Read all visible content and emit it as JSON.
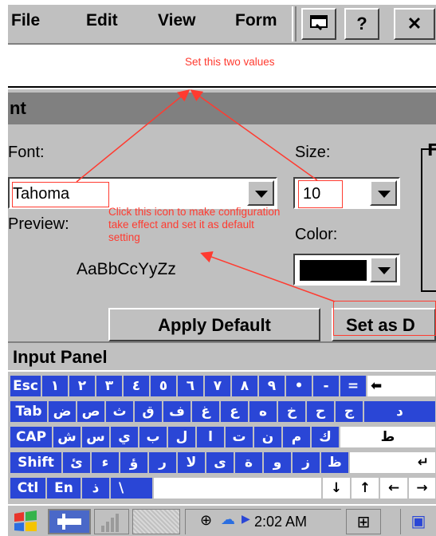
{
  "menu": {
    "file": "File",
    "edit": "Edit",
    "view": "View",
    "format": "Form",
    "help_btn": "?",
    "close_btn": "✕"
  },
  "dialog": {
    "title": "nt",
    "font_label": "Font:",
    "font_value": "Tahoma",
    "size_label": "Size:",
    "size_value": "10",
    "preview_label": "Preview:",
    "preview_text": "AaBbCcYyZz",
    "color_label": "Color:",
    "color_value": "#000000",
    "apply_default": "Apply Default",
    "set_as_default": "Set as D"
  },
  "annotations": {
    "set_values": "Set this two values",
    "click_icon": "Click this icon to make configuration take effect and set it as default setting"
  },
  "input_panel": {
    "title": "Input Panel",
    "rows": [
      [
        "Esc",
        "١",
        "٢",
        "٣",
        "٤",
        "٥",
        "٦",
        "٧",
        "٨",
        "٩",
        "•",
        "-",
        "=",
        "⬅"
      ],
      [
        "Tab",
        "ض",
        "ص",
        "ث",
        "ق",
        "ف",
        "غ",
        "ع",
        "ه",
        "خ",
        "ح",
        "ج",
        "د"
      ],
      [
        "CAP",
        "ش",
        "س",
        "ي",
        "ب",
        "ل",
        "ا",
        "ت",
        "ن",
        "م",
        "ك",
        "ط"
      ],
      [
        "Shift",
        "ئ",
        "ء",
        "ؤ",
        "ر",
        "لا",
        "ى",
        "ة",
        "و",
        "ز",
        "ظ",
        "↵"
      ],
      [
        "Ctl",
        "En",
        "ذ",
        "\\",
        "",
        "↓",
        "↑",
        "←",
        "→"
      ]
    ]
  },
  "taskbar": {
    "time": "2:02 AM"
  }
}
